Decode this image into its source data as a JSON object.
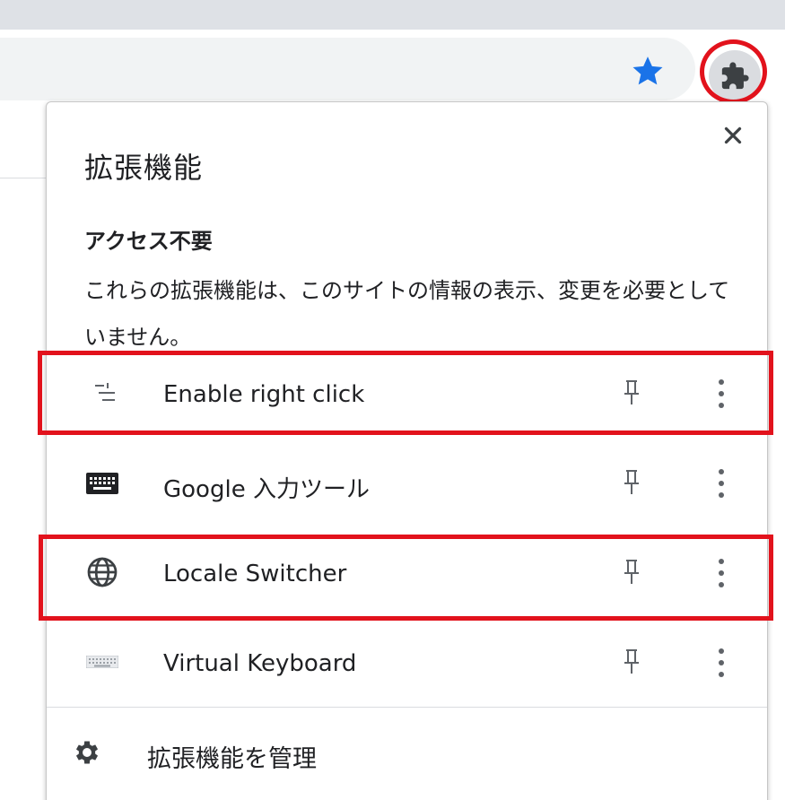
{
  "panel": {
    "title": "拡張機能",
    "section_heading": "アクセス不要",
    "section_description": "これらの拡張機能は、このサイトの情報の表示、変更を必要としていません。"
  },
  "extensions": [
    {
      "name": "Enable right click",
      "icon": "tune-icon",
      "highlighted": true
    },
    {
      "name": "Google 入力ツール",
      "icon": "keyboard-icon",
      "highlighted": false
    },
    {
      "name": "Locale Switcher",
      "icon": "globe-icon",
      "highlighted": true
    },
    {
      "name": "Virtual Keyboard",
      "icon": "virtual-keyboard-icon",
      "highlighted": false
    }
  ],
  "footer": {
    "manage_label": "拡張機能を管理",
    "icon": "gear-icon"
  },
  "toolbar": {
    "bookmark_icon": "star-icon",
    "extensions_icon": "puzzle-icon"
  },
  "colors": {
    "highlight": "#e2121c",
    "star": "#1a73e8",
    "text": "#202124",
    "icon_gray": "#5f6368"
  }
}
